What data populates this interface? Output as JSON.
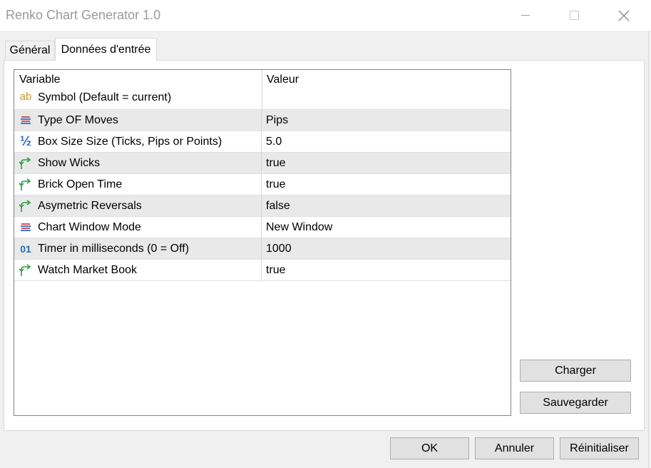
{
  "window": {
    "title": "Renko Chart Generator 1.0"
  },
  "tabs": [
    {
      "label": "Général",
      "active": false
    },
    {
      "label": "Données d'entrée",
      "active": true
    }
  ],
  "table": {
    "headers": {
      "variable": "Variable",
      "value": "Valeur"
    },
    "rows": [
      {
        "icon": "text-ab-icon",
        "variable": "Symbol (Default = current)",
        "value": ""
      },
      {
        "icon": "list-enum-icon",
        "variable": "Type OF Moves",
        "value": "Pips"
      },
      {
        "icon": "fraction-half-icon",
        "variable": "Box Size Size (Ticks, Pips or Points)",
        "value": "5.0"
      },
      {
        "icon": "bool-arrow-icon",
        "variable": "Show Wicks",
        "value": "true"
      },
      {
        "icon": "bool-arrow-icon",
        "variable": "Brick Open Time",
        "value": "true"
      },
      {
        "icon": "bool-arrow-icon",
        "variable": "Asymetric Reversals",
        "value": "false"
      },
      {
        "icon": "list-enum-icon",
        "variable": "Chart Window Mode",
        "value": "New Window"
      },
      {
        "icon": "integer-01-icon",
        "variable": "Timer in milliseconds (0 = Off)",
        "value": "1000"
      },
      {
        "icon": "bool-arrow-icon",
        "variable": "Watch Market Book",
        "value": "true"
      }
    ]
  },
  "side_buttons": {
    "load": "Charger",
    "save": "Sauvegarder"
  },
  "footer_buttons": {
    "ok": "OK",
    "cancel": "Annuler",
    "reset": "Réinitialiser"
  },
  "icon_glyphs": {
    "ab": "ab",
    "half": "½",
    "int": "01"
  },
  "colors": {
    "ab_icon": "#c8962a",
    "enum_red": "#d9534f",
    "enum_blue": "#3a7bd5",
    "half_icon": "#2d6bb3",
    "bool_icon": "#2e9e3e",
    "int_icon": "#2d6bb3"
  }
}
